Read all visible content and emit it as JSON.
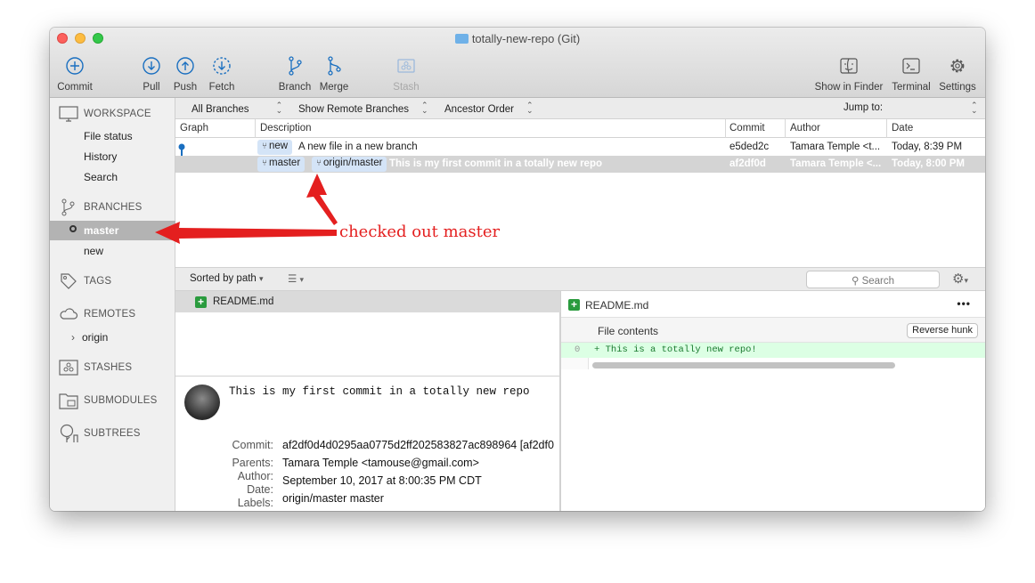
{
  "window": {
    "title": "totally-new-repo (Git)"
  },
  "toolbar": {
    "commit": "Commit",
    "pull": "Pull",
    "push": "Push",
    "fetch": "Fetch",
    "branch": "Branch",
    "merge": "Merge",
    "stash": "Stash",
    "show_in_finder": "Show in Finder",
    "terminal": "Terminal",
    "settings": "Settings"
  },
  "sidebar": {
    "workspace": {
      "title": "WORKSPACE",
      "items": [
        "File status",
        "History",
        "Search"
      ]
    },
    "branches": {
      "title": "BRANCHES",
      "items": [
        "master",
        "new"
      ],
      "selected": "master"
    },
    "tags": {
      "title": "TAGS"
    },
    "remotes": {
      "title": "REMOTES",
      "items": [
        "origin"
      ]
    },
    "stashes": {
      "title": "STASHES"
    },
    "submodules": {
      "title": "SUBMODULES"
    },
    "subtrees": {
      "title": "SUBTREES"
    }
  },
  "filter": {
    "branches": "All Branches",
    "remote": "Show Remote Branches",
    "order": "Ancestor Order",
    "jump_to": "Jump to:"
  },
  "columns": {
    "graph": "Graph",
    "description": "Description",
    "commit": "Commit",
    "author": "Author",
    "date": "Date"
  },
  "commits": [
    {
      "tags": [
        "new"
      ],
      "description": "A new file in a new branch",
      "commit": "e5ded2c",
      "author": "Tamara Temple <t...",
      "date": "Today, 8:39 PM"
    },
    {
      "tags": [
        "master",
        "origin/master"
      ],
      "description": "This is my first commit in a totally new repo",
      "commit": "af2df0d",
      "author": "Tamara Temple <...",
      "date": "Today, 8:00 PM"
    }
  ],
  "annotation": "checked out master",
  "files": {
    "sort": "Sorted by path",
    "search_placeholder": "Search",
    "items": [
      "README.md"
    ]
  },
  "details": {
    "message": "This is my first commit in a totally new repo",
    "commit_label": "Commit:",
    "commit_value": "af2df0d4d0295aa0775d2ff202583827ac898964 [af2df0",
    "parents_label": "Parents:",
    "parents_value": "Tamara Temple <tamouse@gmail.com>",
    "author_label": "Author:",
    "date_label": "Date:",
    "date_value": "September 10, 2017 at 8:00:35 PM CDT",
    "labels_label": "Labels:",
    "labels_value": "origin/master master"
  },
  "diff": {
    "file": "README.md",
    "more": "•••",
    "hunk_title": "File contents",
    "reverse_hunk": "Reverse hunk",
    "line_number": "0",
    "line_text": "+ This is a totally new repo!"
  },
  "colors": {
    "accent": "#1a6fc0",
    "added": "#2a9b3e",
    "annotation": "#e41f1f"
  }
}
